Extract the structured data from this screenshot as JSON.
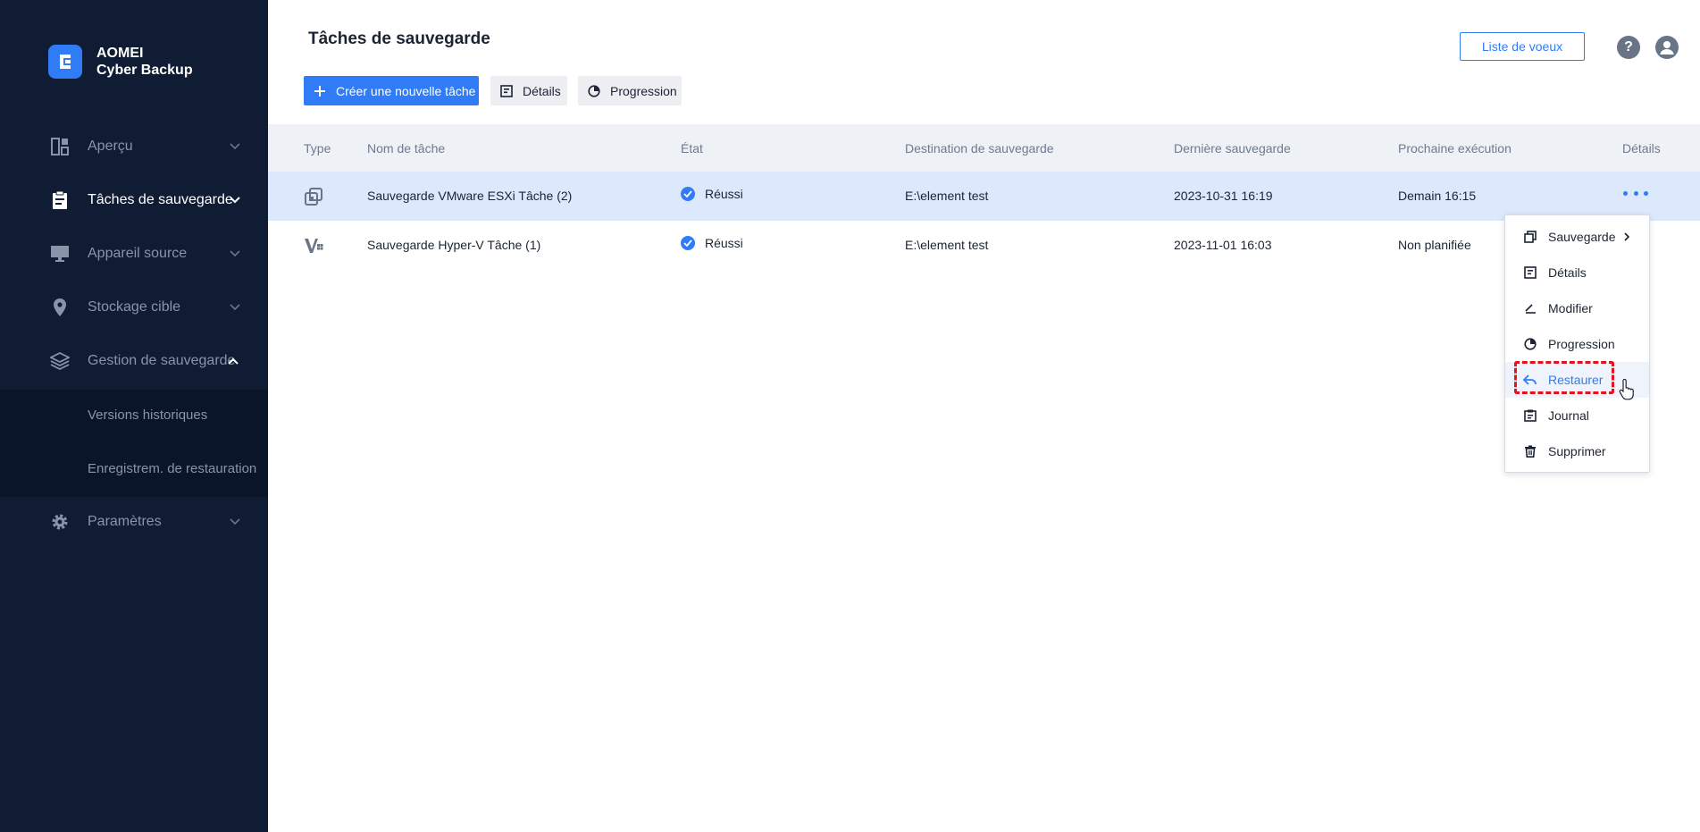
{
  "app": {
    "brand_line1": "AOMEI",
    "brand_line2": "Cyber Backup"
  },
  "sidebar": {
    "items": [
      {
        "label": "Aperçu",
        "icon": "dashboard-icon"
      },
      {
        "label": "Tâches de sauvegarde",
        "icon": "clipboard-icon",
        "active": true
      },
      {
        "label": "Appareil source",
        "icon": "monitor-icon"
      },
      {
        "label": "Stockage cible",
        "icon": "location-pin-icon"
      },
      {
        "label": "Gestion de sauvegarde",
        "icon": "layers-icon",
        "expanded": true
      },
      {
        "label": "Paramètres",
        "icon": "gear-icon"
      }
    ],
    "subitems": [
      {
        "label": "Versions historiques"
      },
      {
        "label": "Enregistrem. de restauration"
      }
    ]
  },
  "header": {
    "title": "Tâches de sauvegarde",
    "create_label": "Créer une nouvelle tâche",
    "details_label": "Détails",
    "progress_label": "Progression",
    "wishlist_label": "Liste de voeux",
    "help_glyph": "?"
  },
  "table": {
    "columns": [
      "Type",
      "Nom de tâche",
      "État",
      "Destination de sauvegarde",
      "Dernière sauvegarde",
      "Prochaine exécution",
      "Détails"
    ],
    "rows": [
      {
        "type_icon": "vmware-icon",
        "name": "Sauvegarde VMware ESXi Tâche (2)",
        "status": "Réussi",
        "destination": "E:\\element test",
        "last": "2023-10-31 16:19",
        "next": "Demain 16:15"
      },
      {
        "type_icon": "hyperv-icon",
        "name": "Sauvegarde Hyper-V Tâche (1)",
        "status": "Réussi",
        "destination": "E:\\element test",
        "last": "2023-11-01 16:03",
        "next": "Non planifiée"
      }
    ]
  },
  "context_menu": {
    "items": [
      {
        "label": "Sauvegarde",
        "icon": "copy-icon",
        "submenu": true
      },
      {
        "label": "Détails",
        "icon": "details-icon"
      },
      {
        "label": "Modifier",
        "icon": "edit-icon"
      },
      {
        "label": "Progression",
        "icon": "progress-icon"
      },
      {
        "label": "Restaurer",
        "icon": "restore-icon",
        "hover": true
      },
      {
        "label": "Journal",
        "icon": "journal-icon"
      },
      {
        "label": "Supprimer",
        "icon": "trash-icon"
      }
    ]
  },
  "colors": {
    "sidebar_bg": "#101c33",
    "accent": "#2f7cf6",
    "row_selected": "#dce8fb",
    "highlight": "#e0141e"
  }
}
